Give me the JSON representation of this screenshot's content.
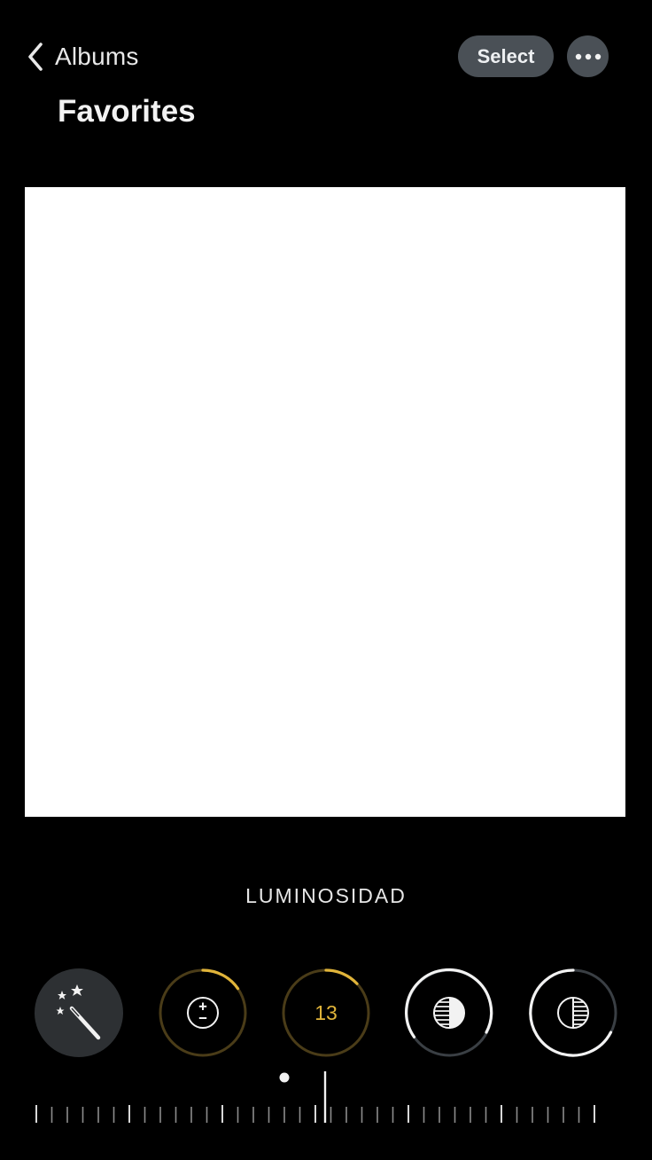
{
  "nav": {
    "back_label": "Albums",
    "back_icon": "chevron-left-icon"
  },
  "header": {
    "title": "Favorites",
    "select_label": "Select",
    "more_icon": "ellipsis-icon"
  },
  "photo": {
    "content": "blank white image"
  },
  "edit": {
    "adjustment_name": "LUMINOSIDAD",
    "tools": [
      {
        "name": "auto-enhance",
        "icon": "magic-wand-icon",
        "selected": true
      },
      {
        "name": "exposure",
        "icon": "exposure-plus-minus-icon",
        "edited": true
      },
      {
        "name": "brilliance",
        "value": "13",
        "edited": true
      },
      {
        "name": "highlights",
        "icon": "highlights-icon"
      },
      {
        "name": "shadows",
        "icon": "shadows-icon"
      }
    ],
    "slider": {
      "position": 0.5
    }
  },
  "colors": {
    "accent": "#e0b43a",
    "background": "#000000",
    "button": "#4a5056"
  }
}
